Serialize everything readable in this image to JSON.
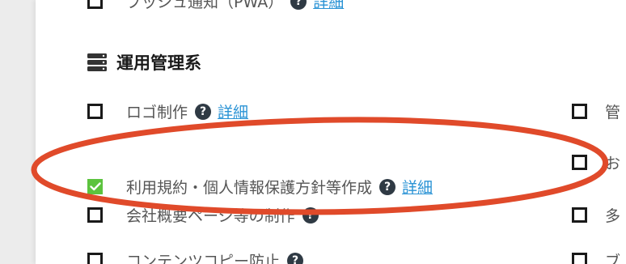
{
  "top_row": {
    "label": "プッシュ通知（PWA）",
    "detail": "詳細"
  },
  "section": {
    "title": "運用管理系",
    "icon": "server-icon"
  },
  "left_items": [
    {
      "label": "ロゴ制作",
      "checked": false,
      "has_help": true,
      "detail": "詳細"
    },
    {
      "label": "利用規約・個人情報保護方針等作成",
      "checked": true,
      "has_help": true,
      "detail": "詳細"
    },
    {
      "label": "会社概要ページ等の制作",
      "checked": false,
      "has_help": true,
      "detail": ""
    },
    {
      "label": "コンテンツコピー防止",
      "checked": false,
      "has_help": true,
      "detail": ""
    }
  ],
  "right_items": [
    {
      "label": "管"
    },
    {
      "label": "お"
    },
    {
      "label": "多"
    },
    {
      "label": "ブ"
    }
  ],
  "colors": {
    "accent_link": "#2a93d5",
    "checked": "#5cc33e",
    "annotation": "#e04a2a"
  }
}
